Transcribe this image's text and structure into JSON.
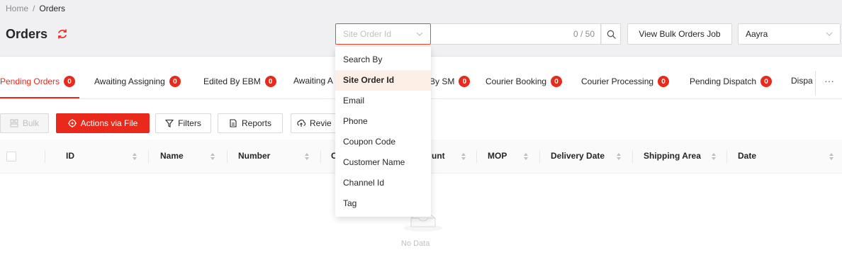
{
  "breadcrumb": {
    "home": "Home",
    "separator": "/",
    "current": "Orders"
  },
  "page": {
    "title": "Orders"
  },
  "search": {
    "type_placeholder": "Site Order Id",
    "counter": "0 / 50",
    "options": [
      "Search By",
      "Site Order Id",
      "Email",
      "Phone",
      "Coupon Code",
      "Customer Name",
      "Channel Id",
      "Tag"
    ],
    "selected_option": "Site Order Id"
  },
  "header_actions": {
    "bulk_job_label": "View Bulk Orders Job",
    "account_value": "Aayra"
  },
  "tabs": [
    {
      "label": "Pending Orders",
      "count": "0"
    },
    {
      "label": "Awaiting Assigning",
      "count": "0"
    },
    {
      "label": "Edited By EBM",
      "count": "0"
    },
    {
      "label": "Awaiting A",
      "count": ""
    },
    {
      "label": "By SM",
      "count": "0"
    },
    {
      "label": "Courier Booking",
      "count": "0"
    },
    {
      "label": "Courier Processing",
      "count": "0"
    },
    {
      "label": "Pending Dispatch",
      "count": "0"
    },
    {
      "label": "Dispa",
      "count": ""
    }
  ],
  "tabs_more": "···",
  "toolbar": {
    "bulk": "Bulk",
    "actions_via_file": "Actions via File",
    "filters": "Filters",
    "reports": "Reports",
    "review": "Revie"
  },
  "table": {
    "columns": [
      "ID",
      "Name",
      "Number",
      "C",
      "unt",
      "MOP",
      "Delivery Date",
      "Shipping Area",
      "Date"
    ],
    "empty_text": "No Data"
  },
  "colors": {
    "accent": "#e8291c",
    "active_border": "#e84a3b",
    "selected_option_bg": "#fdeee6"
  },
  "icons": [
    "refresh-icon",
    "chevron-down-icon",
    "search-icon",
    "bulk-icon",
    "target-icon",
    "filter-icon",
    "report-icon",
    "upload-cloud-icon",
    "sort-icon",
    "empty-box-icon",
    "more-icon"
  ]
}
